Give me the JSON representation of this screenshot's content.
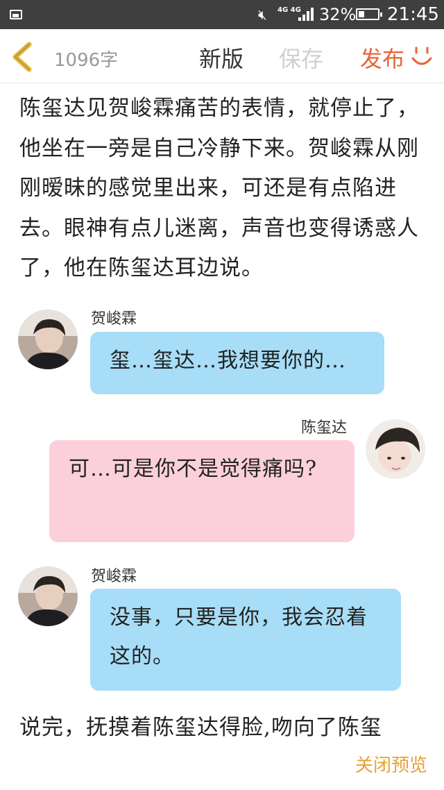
{
  "status_bar": {
    "network": "4G 4G",
    "battery_percent": "32%",
    "battery_level": 0.32,
    "time": "21:45",
    "icons": [
      "image-icon",
      "mute-icon",
      "signal-icon",
      "battery-icon"
    ]
  },
  "toolbar": {
    "word_count": "1096字",
    "new_version": "新版",
    "save": "保存",
    "publish": "发布",
    "icons": [
      "back-arrow-icon",
      "smile-icon"
    ],
    "colors": {
      "publish": "#e8643a",
      "disabled": "#cfcfcf",
      "back": "#e2b43a"
    }
  },
  "content": {
    "paragraph_1": "陈玺达见贺峻霖痛苦的表情，就停止了，他坐在一旁是自己冷静下来。贺峻霖从刚刚暧昧的感觉里出来，可还是有点陷进去。眼神有点儿迷离，声音也变得诱惑人了，他在陈玺达耳边说。",
    "messages": [
      {
        "speaker": "贺峻霖",
        "text": "玺…玺达…我想要你的…",
        "side": "left",
        "color": "#a7ddf7"
      },
      {
        "speaker": "陈玺达",
        "text": "可…可是你不是觉得痛吗?",
        "side": "right",
        "color": "#fbd0db"
      },
      {
        "speaker": "贺峻霖",
        "text": "没事，只要是你，我会忍着这的。",
        "side": "left",
        "color": "#a7ddf7"
      }
    ],
    "paragraph_2": "说完，抚摸着陈玺达得脸,吻向了陈玺"
  },
  "footer": {
    "close_preview": "关闭预览"
  }
}
